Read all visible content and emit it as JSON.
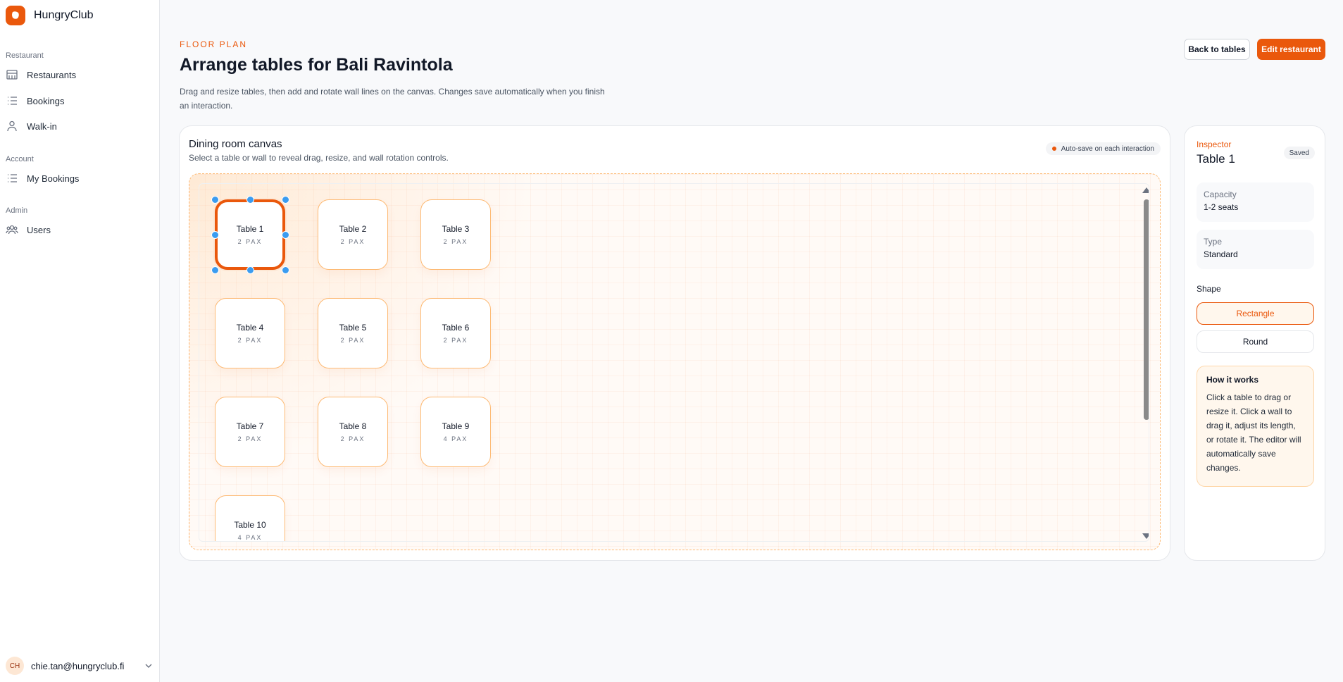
{
  "brand": {
    "name": "HungryClub"
  },
  "sidebar": {
    "sections": [
      {
        "title": "Restaurant",
        "items": [
          {
            "label": "Restaurants",
            "icon": "store-icon"
          },
          {
            "label": "Bookings",
            "icon": "list-icon"
          },
          {
            "label": "Walk-in",
            "icon": "person-icon"
          }
        ]
      },
      {
        "title": "Account",
        "items": [
          {
            "label": "My Bookings",
            "icon": "list-icon"
          }
        ]
      },
      {
        "title": "Admin",
        "items": [
          {
            "label": "Users",
            "icon": "users-icon"
          }
        ]
      }
    ],
    "user": {
      "initials": "CH",
      "email": "chie.tan@hungryclub.fi"
    }
  },
  "header": {
    "eyebrow": "FLOOR PLAN",
    "title": "Arrange tables for Bali Ravintola",
    "description": "Drag and resize tables, then add and rotate wall lines on the canvas. Changes save automatically when you finish an interaction.",
    "back_button": "Back to tables",
    "edit_button": "Edit restaurant"
  },
  "canvas": {
    "title": "Dining room canvas",
    "subtitle": "Select a table or wall to reveal drag, resize, and wall rotation controls.",
    "autosave_badge": "Auto-save on each interaction",
    "tables": [
      {
        "name": "Table 1",
        "pax": "2 PAX",
        "selected": true
      },
      {
        "name": "Table 2",
        "pax": "2 PAX"
      },
      {
        "name": "Table 3",
        "pax": "2 PAX"
      },
      {
        "name": "Table 4",
        "pax": "2 PAX"
      },
      {
        "name": "Table 5",
        "pax": "2 PAX"
      },
      {
        "name": "Table 6",
        "pax": "2 PAX"
      },
      {
        "name": "Table 7",
        "pax": "2 PAX"
      },
      {
        "name": "Table 8",
        "pax": "2 PAX"
      },
      {
        "name": "Table 9",
        "pax": "4 PAX"
      },
      {
        "name": "Table 10",
        "pax": "4 PAX"
      }
    ]
  },
  "inspector": {
    "label": "Inspector",
    "title": "Table 1",
    "status": "Saved",
    "capacity_label": "Capacity",
    "capacity_value": "1-2 seats",
    "type_label": "Type",
    "type_value": "Standard",
    "shape_label": "Shape",
    "shape_rectangle": "Rectangle",
    "shape_round": "Round",
    "selected_shape": "Rectangle",
    "how_title": "How it works",
    "how_text": "Click a table to drag or resize it. Click a wall to drag it, adjust its length, or rotate it. The editor will automatically save changes."
  },
  "colors": {
    "accent": "#ea580c",
    "handle": "#3b9cf0"
  }
}
